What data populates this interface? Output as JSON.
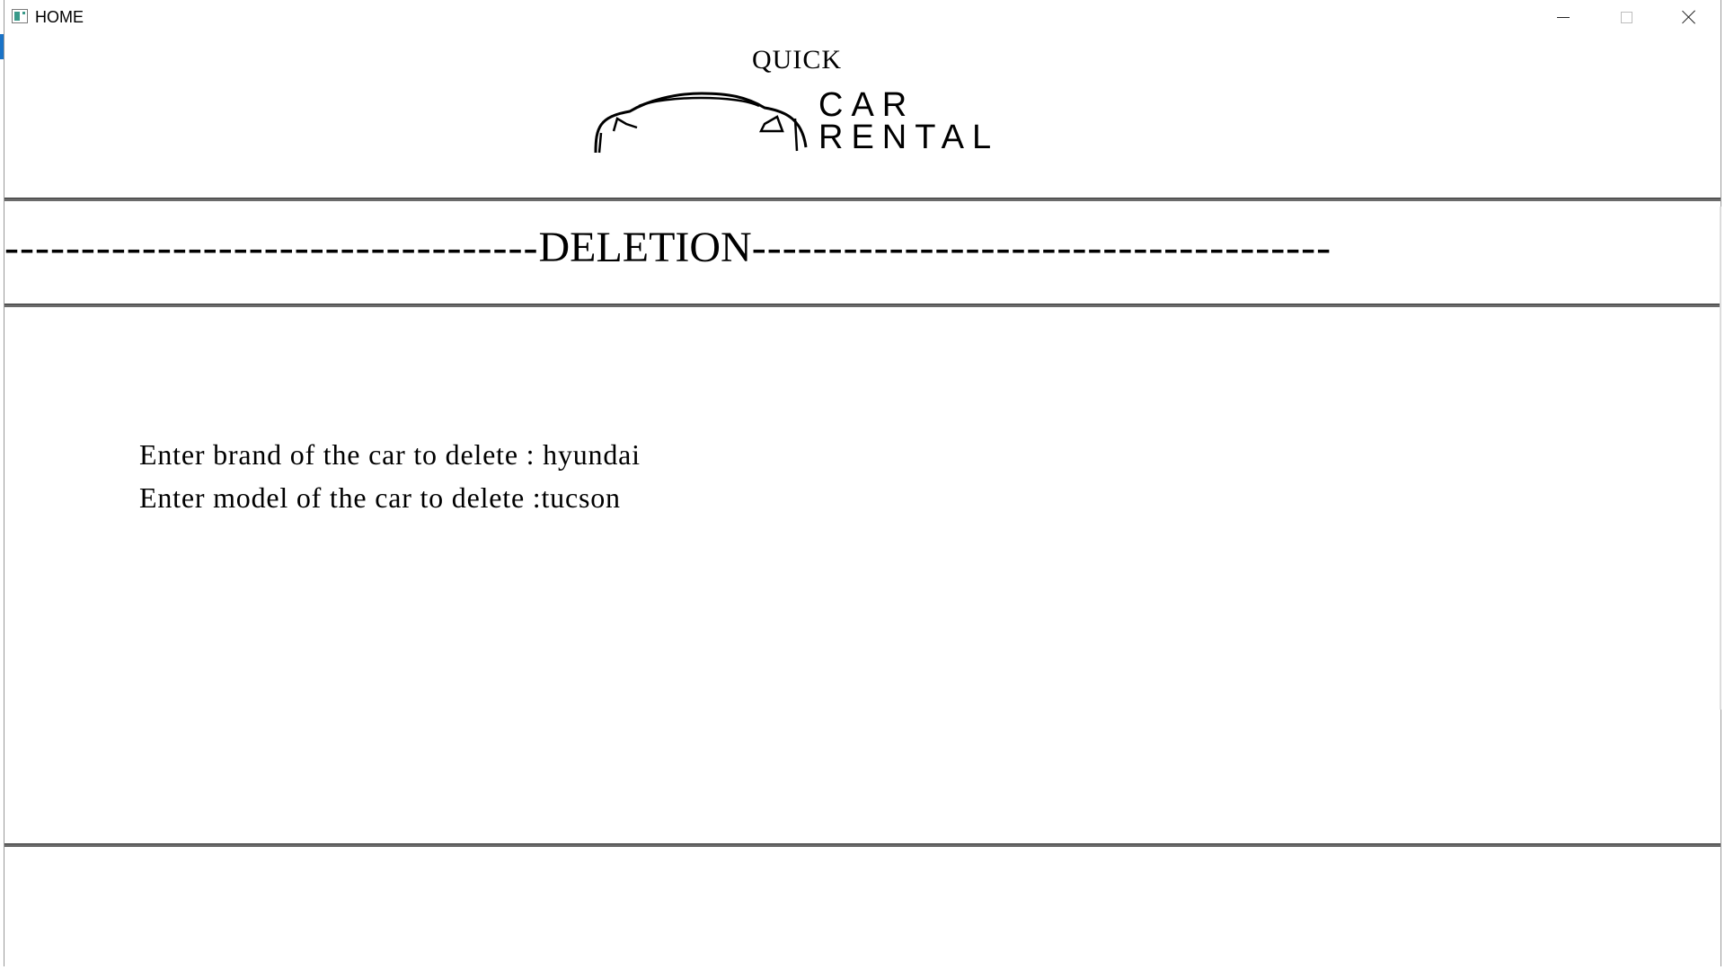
{
  "window": {
    "title": "HOME",
    "controls": {
      "minimize_icon": "minimize-icon",
      "maximize_icon": "maximize-icon",
      "close_icon": "close-icon"
    }
  },
  "logo": {
    "top_word": "QUICK",
    "word1": "CAR",
    "word2": "RENTAL",
    "image_icon": "car-outline-icon"
  },
  "section": {
    "dashes_left": "-----------------------------------",
    "title": "DELETION",
    "dashes_right": "--------------------------------------"
  },
  "form": {
    "brand_prompt": "Enter brand of the car to delete : ",
    "brand_value": "hyundai",
    "model_prompt": "Enter model of the car to delete :",
    "model_value": "tucson"
  },
  "colors": {
    "background": "#ffffff",
    "text": "#000000",
    "rule": "#6a6a6a",
    "accent": "#6cc04a",
    "taskbar_edge": "#1a73c7"
  }
}
